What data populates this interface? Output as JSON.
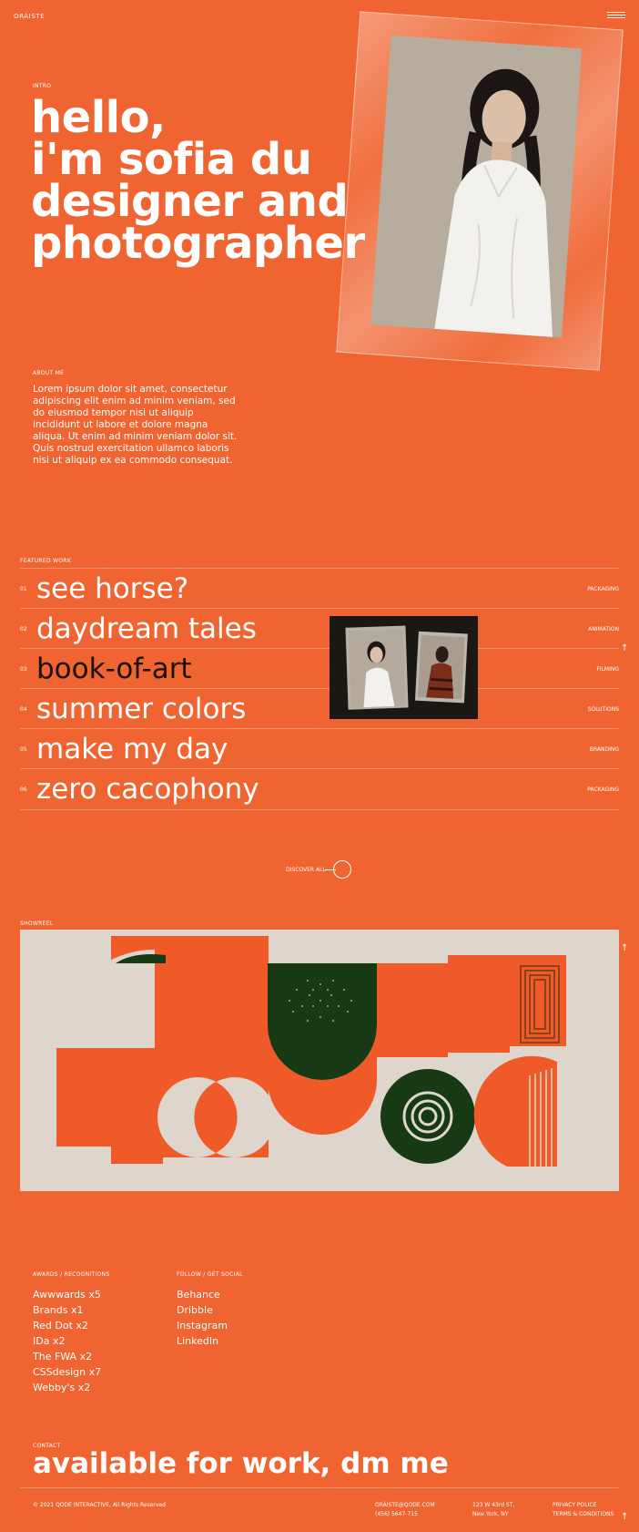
{
  "header": {
    "logo": "ORÁISTE"
  },
  "hero": {
    "label": "INTRO",
    "title_lines": [
      "hello,",
      "i'm sofia du",
      "designer and",
      "photographer"
    ]
  },
  "about": {
    "label": "ABOUT ME",
    "text": "Lorem ipsum dolor sit amet, consectetur adipiscing elit enim ad minim veniam, sed do eiusmod tempor nisi ut aliquip incididunt ut labore et dolore magna aliqua. Ut enim ad minim veniam dolor sit. Quis nostrud exercitation ullamco laboris nisi ut aliquip ex ea commodo consequat."
  },
  "featured": {
    "label": "FEATURED WORK",
    "items": [
      {
        "num": "01",
        "title": "see horse?",
        "category": "PACKAGING"
      },
      {
        "num": "02",
        "title": "daydream tales",
        "category": "ANIMATION"
      },
      {
        "num": "03",
        "title": "book-of-art",
        "category": "FILMING"
      },
      {
        "num": "04",
        "title": "summer colors",
        "category": "SOLUTIONS"
      },
      {
        "num": "05",
        "title": "make my day",
        "category": "BRANDING"
      },
      {
        "num": "06",
        "title": "zero cacophony",
        "category": "PACKAGING"
      }
    ],
    "discover": "DISCOVER ALL"
  },
  "showreel": {
    "label": "SHOWREEL"
  },
  "awards": {
    "label": "AWARDS / RECOGNITIONS",
    "items": [
      "Awwwards x5",
      "Brands x1",
      "Red Dot x2",
      "IDa x2",
      "The FWA x2",
      "CSSdesign x7",
      "Webby's x2"
    ]
  },
  "social": {
    "label": "FOLLOW / GET SOCIAL",
    "items": [
      "Behance",
      "Dribble",
      "Instagram",
      "LinkedIn"
    ]
  },
  "contact": {
    "label": "CONTACT",
    "title": "available for work, dm me"
  },
  "footer": {
    "copyright": "© 2021 QODE INTERACTIVE, All Rights Reserved",
    "email": "ORÁISTE@QODE.COM",
    "phone": "(456) 5647-715",
    "address1": "123 W 43rd ST,",
    "address2": "New York, NY",
    "privacy": "PRIVACY POLICE",
    "terms": "TERMS & CONDITIONS"
  },
  "colors": {
    "background": "#ef6430",
    "text": "#ffffff",
    "active": "#1a1208",
    "showreel_cream": "#ded6cc",
    "showreel_green": "#173a14"
  }
}
